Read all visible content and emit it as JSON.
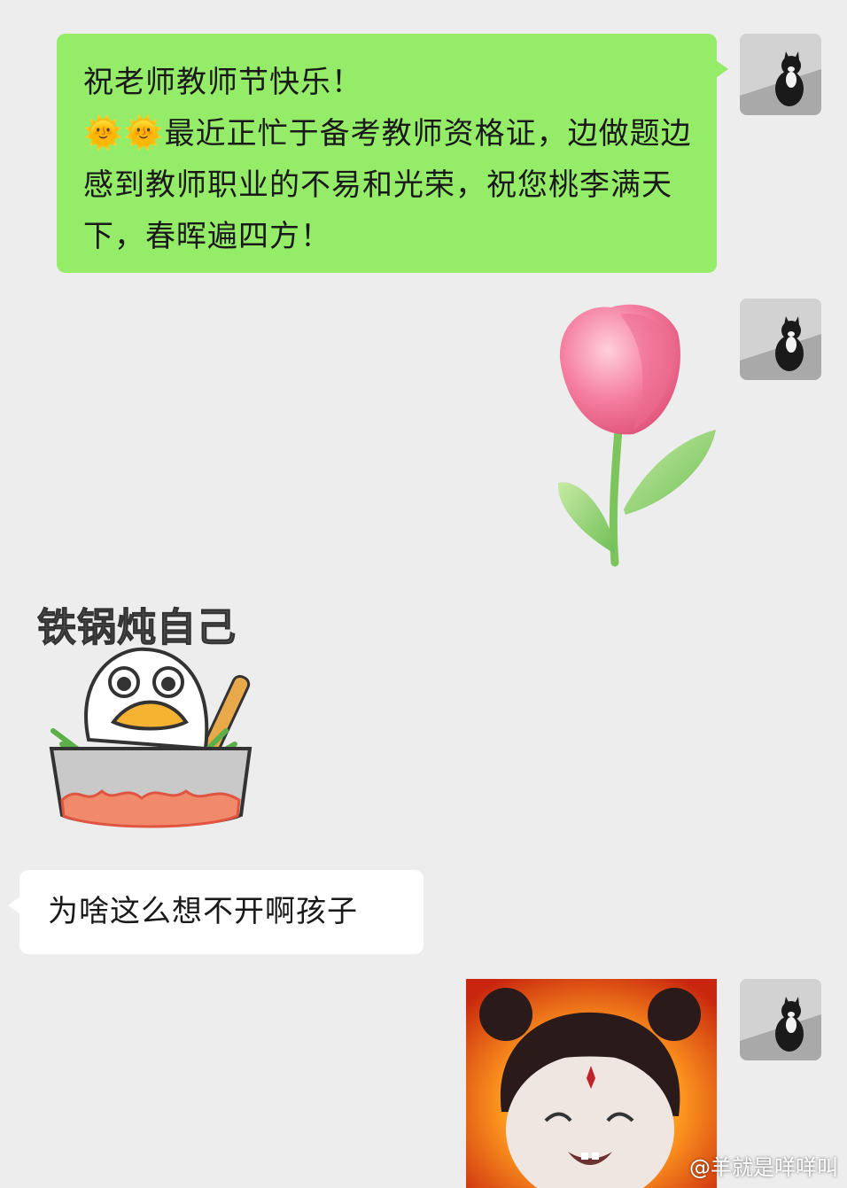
{
  "messages": {
    "greeting": {
      "line1": "祝老师教师节快乐！",
      "emojis": "🌞🌞",
      "line2": "最近正忙于备考教师资格证，边做题边感到教师职业的不易和光荣，祝您桃李满天下，春晖遍四方！"
    },
    "reply": "为啥这么想不开啊孩子"
  },
  "stickers": {
    "tulip": "tulip-sticker",
    "duck_caption": "铁锅炖自己",
    "nezha": "nezha-fire-sticker"
  },
  "watermark": "@羊就是咩咩叫",
  "colors": {
    "background": "#ededed",
    "my_bubble": "#95ec69",
    "other_bubble": "#ffffff"
  }
}
